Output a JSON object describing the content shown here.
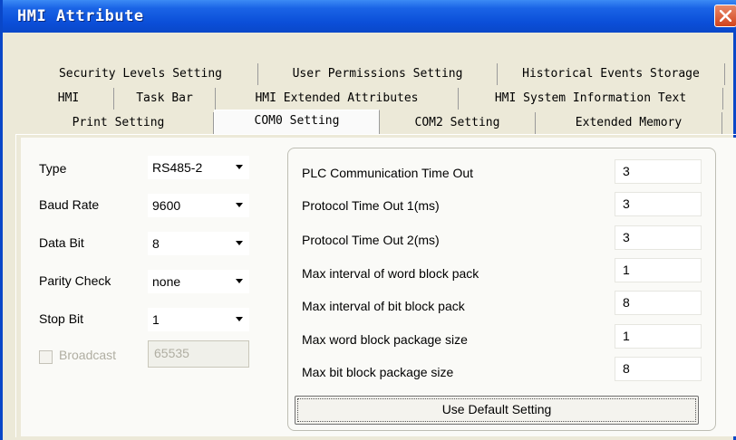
{
  "window": {
    "title": "HMI Attribute",
    "close_icon": "close-icon"
  },
  "tabs": {
    "row1": [
      "Security Levels Setting",
      "User Permissions Setting",
      "Historical Events Storage"
    ],
    "row2": [
      "HMI",
      "Task Bar",
      "HMI Extended Attributes",
      "HMI System Information Text"
    ],
    "row3": [
      "Print Setting",
      "COM0 Setting",
      "COM2 Setting",
      "Extended Memory"
    ],
    "active": "COM0 Setting"
  },
  "serial": {
    "type_label": "Type",
    "type_value": "RS485-2",
    "baud_label": "Baud Rate",
    "baud_value": "9600",
    "databit_label": "Data Bit",
    "databit_value": "8",
    "parity_label": "Parity Check",
    "parity_value": "none",
    "stopbit_label": "Stop Bit",
    "stopbit_value": "1",
    "broadcast_label": "Broadcast",
    "broadcast_value": "65535",
    "broadcast_checked": false
  },
  "comm": {
    "rows": [
      {
        "label": "PLC Communication Time Out",
        "value": "3"
      },
      {
        "label": "Protocol Time Out 1(ms)",
        "value": "3"
      },
      {
        "label": "Protocol Time Out 2(ms)",
        "value": "3"
      },
      {
        "label": "Max interval of word block pack",
        "value": "1"
      },
      {
        "label": "Max interval of bit block pack",
        "value": "8"
      },
      {
        "label": "Max word block package size",
        "value": "1"
      },
      {
        "label": "Max bit block package size",
        "value": "8"
      }
    ],
    "default_button": "Use Default Setting"
  },
  "colors": {
    "titlebar": "#0A48C9",
    "close": "#D1431C",
    "dialog_bg": "#ECE9D8"
  }
}
